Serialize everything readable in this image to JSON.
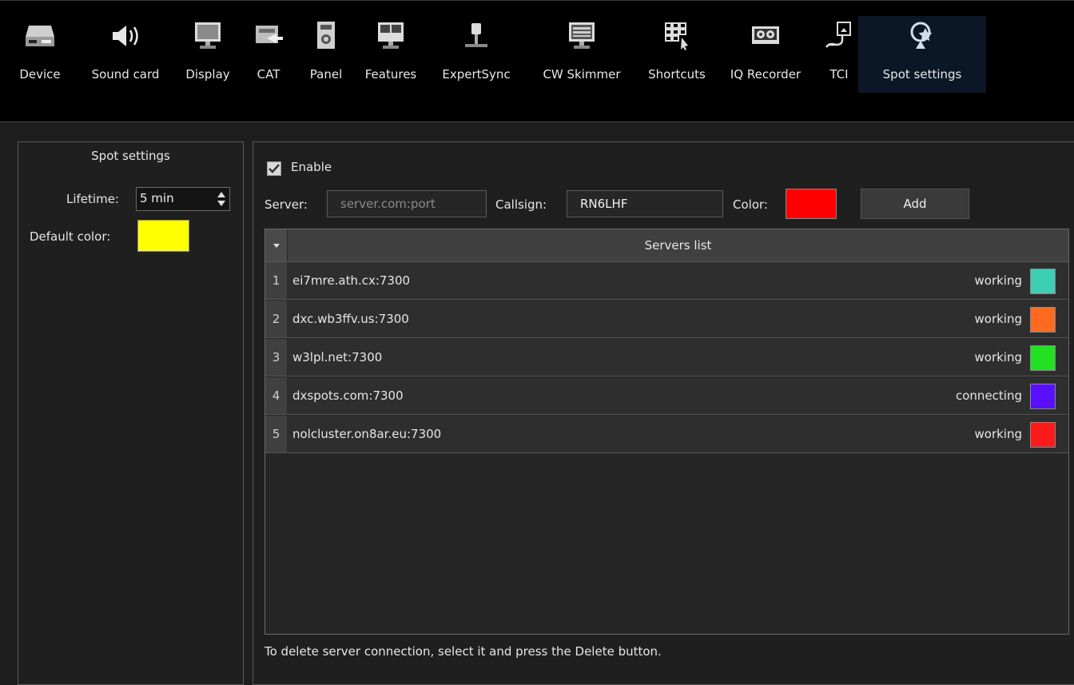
{
  "toolbar": {
    "items": [
      {
        "label": "Device",
        "icon": "device-icon"
      },
      {
        "label": "Sound card",
        "icon": "speaker-icon"
      },
      {
        "label": "Display",
        "icon": "monitor-icon"
      },
      {
        "label": "CAT",
        "icon": "cat-icon"
      },
      {
        "label": "Panel",
        "icon": "panel-icon"
      },
      {
        "label": "Features",
        "icon": "features-icon"
      },
      {
        "label": "ExpertSync",
        "icon": "expertsync-icon"
      },
      {
        "label": "CW Skimmer",
        "icon": "keyboard-icon"
      },
      {
        "label": "Shortcuts",
        "icon": "shortcuts-icon"
      },
      {
        "label": "IQ Recorder",
        "icon": "tape-icon"
      },
      {
        "label": "TCI",
        "icon": "tci-icon"
      },
      {
        "label": "Spot settings",
        "icon": "spot-icon"
      }
    ],
    "active": "Spot settings"
  },
  "left_panel": {
    "title": "Spot settings",
    "lifetime_label": "Lifetime:",
    "lifetime_value": "5 min",
    "default_color_label": "Default color:",
    "default_color": "#ffff00"
  },
  "right_panel": {
    "enable_label": "Enable",
    "enable_checked": true,
    "server_label": "Server:",
    "server_placeholder": "server.com:port",
    "callsign_label": "Callsign:",
    "callsign_value": "RN6LHF",
    "color_label": "Color:",
    "color_value": "#ff0000",
    "add_label": "Add",
    "table_header": "Servers list",
    "rows": [
      {
        "num": "1",
        "server": "ei7mre.ath.cx:7300",
        "status": "working",
        "color": "#3ccfb4"
      },
      {
        "num": "2",
        "server": "dxc.wb3ffv.us:7300",
        "status": "working",
        "color": "#ff6a1e"
      },
      {
        "num": "3",
        "server": "w3lpl.net:7300",
        "status": "working",
        "color": "#22e022"
      },
      {
        "num": "4",
        "server": "dxspots.com:7300",
        "status": "connecting",
        "color": "#5a10ff"
      },
      {
        "num": "5",
        "server": "nolcluster.on8ar.eu:7300",
        "status": "working",
        "color": "#ff1a1a"
      }
    ],
    "hint": "To delete server connection, select it and press the Delete button."
  }
}
